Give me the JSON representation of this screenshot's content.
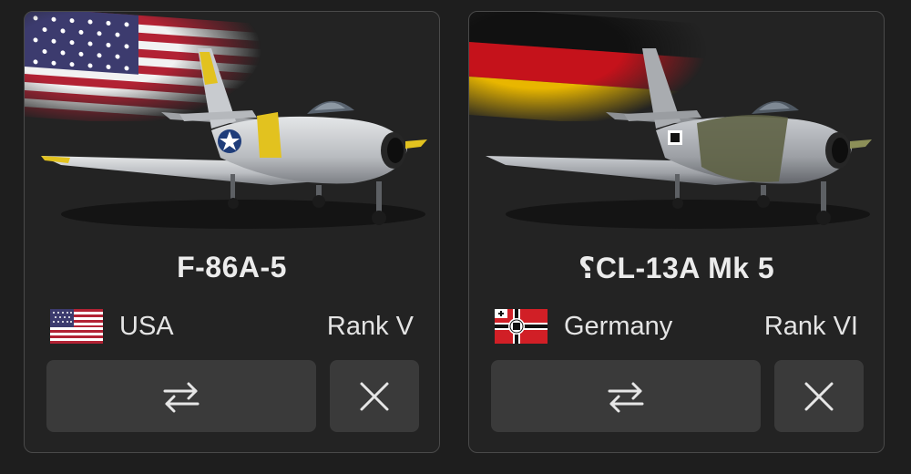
{
  "cards": [
    {
      "name": "F-86A-5",
      "country": "USA",
      "rank": "Rank V",
      "flag_icon": "usa-flag-icon",
      "swap_icon": "swap-arrows-icon",
      "close_icon": "close-icon"
    },
    {
      "name": "⸮CL-13A Mk 5",
      "country": "Germany",
      "rank": "Rank VI",
      "flag_icon": "germany-war-ensign-icon",
      "swap_icon": "swap-arrows-icon",
      "close_icon": "close-icon"
    }
  ],
  "colors": {
    "background": "#1e1e1e",
    "card_border": "#4a4a4a",
    "button": "#3a3a3a",
    "text": "#e9e9e9"
  }
}
